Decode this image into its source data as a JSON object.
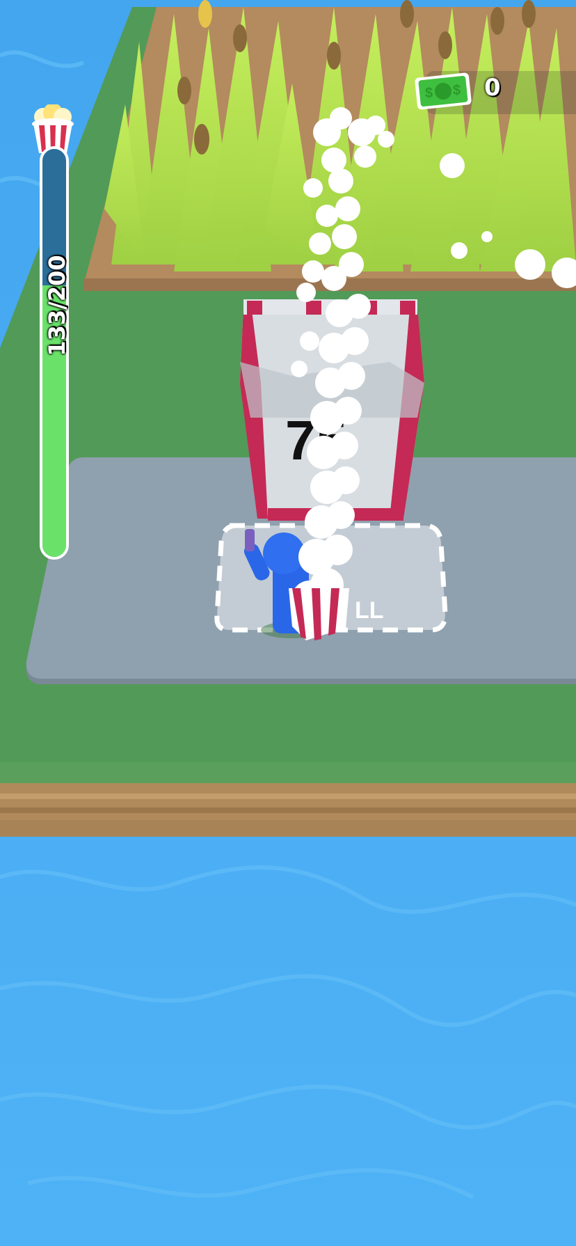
{
  "hud": {
    "money_icon": "cash-bill-icon",
    "money_value": "0",
    "capacity_icon": "popcorn-bucket-icon",
    "capacity_text": "133/200",
    "capacity_fraction": 0.665
  },
  "scene": {
    "sell_zone_label": "LL",
    "machine_text": "75",
    "colors": {
      "water": "#4aa8ee",
      "grass_island": "#529a57",
      "crop": "#b8e05a",
      "sell_pad": "#8fa0ae",
      "popcorn_red": "#c42a55",
      "player": "#2a66e8",
      "money_green": "#3fbf3f",
      "capacity_fill": "#6ae26a"
    }
  }
}
